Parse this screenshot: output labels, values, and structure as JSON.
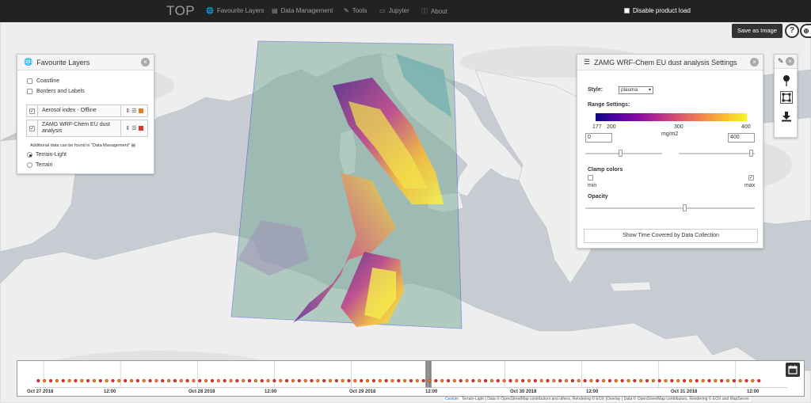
{
  "navbar": {
    "brand": "TOP",
    "items": [
      {
        "label": "Favourite Layers",
        "icon": "globe-icon"
      },
      {
        "label": "Data Management",
        "icon": "database-icon"
      },
      {
        "label": "Tools",
        "icon": "wrench-icon"
      },
      {
        "label": "Jupyter",
        "icon": "monitor-icon"
      },
      {
        "label": "About",
        "icon": "info-icon"
      }
    ],
    "disable_load_label": "Disable product load"
  },
  "map_toolbar": {
    "save_label": "Save as Image",
    "help_label": "?"
  },
  "favourite_layers": {
    "title": "Favourite Layers",
    "overlays": [
      {
        "label": "Coastline",
        "checked": false
      },
      {
        "label": "Borders and Labels",
        "checked": false
      }
    ],
    "layers": [
      {
        "label": "Aerosol index - Offline",
        "checked": true,
        "color": "#e67e22"
      },
      {
        "label": "ZAMG WRF-Chem EU dust analysis",
        "checked": true,
        "color": "#d9342b"
      }
    ],
    "note": "Additional data can be found in \"Data Management\"",
    "baselayers": [
      {
        "label": "Terrain-Light",
        "selected": true
      },
      {
        "label": "Terrain",
        "selected": false
      }
    ]
  },
  "settings": {
    "title": "ZAMG WRF-Chem EU dust analysis Settings",
    "style_label": "Style:",
    "style_value": "plasma",
    "range_label": "Range Settings:",
    "scale_ticks": [
      "177",
      "200",
      "300",
      "400"
    ],
    "unit": "mg/m2",
    "min_value": "0",
    "max_value": "400",
    "clamp_label": "Clamp colors",
    "clamp_min_label": "min",
    "clamp_max_label": "max",
    "clamp_min": false,
    "clamp_max": true,
    "opacity_label": "Opacity",
    "opacity": 0.6,
    "show_time_button": "Show Time Covered by Data Collection"
  },
  "timeline": {
    "labels": [
      "Oct 27 2018",
      "12:00",
      "Oct 28 2018",
      "12:00",
      "Oct 29 2018",
      "12:00",
      "Oct 30 2018",
      "12:00",
      "Oct 31 2018",
      "12:00"
    ]
  },
  "attribution": {
    "cesium": "Cesium",
    "text": "Terrain-Light { Data © OpenStreetMap contributors and others, Rendering © EOX }Overlay { Data © OpenStreetMap contributors, Rendering © EOX and MapServer"
  },
  "colors": {
    "navbar_bg": "#222222",
    "sea": "#c9cfd3",
    "land": "#f2f2f2",
    "orange_layer": "#e67e22",
    "red_layer": "#d9342b"
  }
}
